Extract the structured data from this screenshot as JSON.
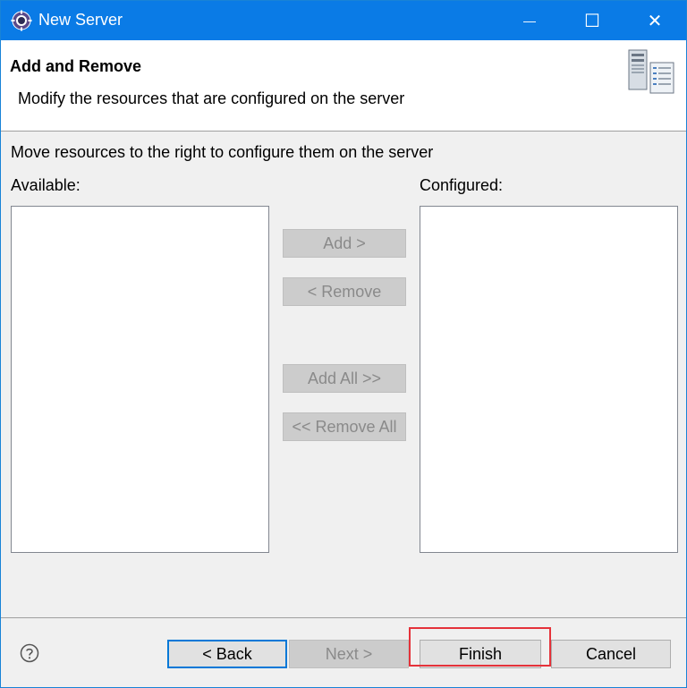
{
  "window": {
    "title": "New Server",
    "minimize_glyph": "—",
    "maximize_glyph": "☐",
    "close_glyph": "✕",
    "accent_color": "#0a7be6"
  },
  "header": {
    "title": "Add and Remove",
    "description": "Modify the resources that are configured on the server",
    "icon": "server-icon"
  },
  "body": {
    "instruction": "Move resources to the right to configure them on the server",
    "available_label": "Available:",
    "configured_label": "Configured:",
    "available_items": [],
    "configured_items": []
  },
  "move_buttons": {
    "add": "Add >",
    "remove": "< Remove",
    "add_all": "Add All >>",
    "remove_all": "<< Remove All"
  },
  "footer": {
    "help_icon": "help-icon",
    "back": "< Back",
    "next": "Next >",
    "finish": "Finish",
    "cancel": "Cancel",
    "highlight_color": "#e5323a"
  }
}
